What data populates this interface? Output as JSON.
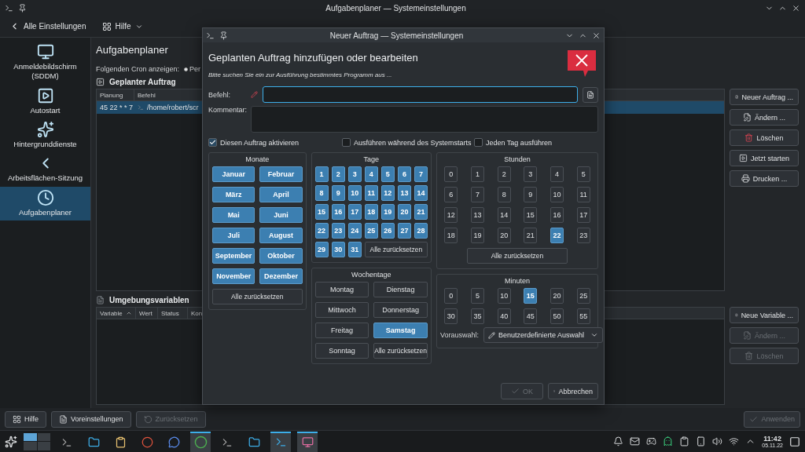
{
  "main_window": {
    "title": "Aufgabenplaner — Systemeinstellungen",
    "back": "Alle Einstellungen",
    "help": "Hilfe"
  },
  "sidebar": {
    "items": [
      {
        "label": "Anmeldebildschirm (SDDM)",
        "selected": false
      },
      {
        "label": "Autostart",
        "selected": false
      },
      {
        "label": "Hintergrunddienste",
        "selected": false
      },
      {
        "label": "Arbeitsflächen-Sitzung",
        "selected": false
      },
      {
        "label": "Aufgabenplaner",
        "selected": true
      }
    ]
  },
  "page": {
    "title": "Aufgabenplaner",
    "cron_label": "Folgenden Cron anzeigen:",
    "cron_option": {
      "label": "Per",
      "selected": true
    },
    "jobs": {
      "title": "Geplanter Auftrag",
      "columns": [
        "Planung",
        "Befehl"
      ],
      "rows": [
        {
          "cells": [
            "45 22 * * 7",
            "/home/robert/scr"
          ],
          "selected": true
        }
      ],
      "buttons": [
        {
          "label": "Neuer Auftrag ...",
          "disabled": false
        },
        {
          "label": "Ändern ...",
          "disabled": false
        },
        {
          "label": "Löschen",
          "disabled": false
        },
        {
          "label": "Jetzt starten",
          "disabled": false
        },
        {
          "label": "Drucken ...",
          "disabled": false
        }
      ]
    },
    "variables": {
      "title": "Umgebungsvariablen",
      "columns": [
        "Variable",
        "Wert",
        "Status",
        "Kon"
      ],
      "buttons": [
        {
          "label": "Neue Variable ...",
          "disabled": false
        },
        {
          "label": "Ändern ...",
          "disabled": true
        },
        {
          "label": "Löschen",
          "disabled": true
        }
      ]
    }
  },
  "footer": {
    "buttons": [
      {
        "label": "Hilfe",
        "disabled": false
      },
      {
        "label": "Voreinstellungen",
        "disabled": false
      },
      {
        "label": "Zurücksetzen",
        "disabled": true
      }
    ],
    "apply": {
      "label": "Anwenden",
      "disabled": true
    }
  },
  "taskbar": {
    "time": "11:42",
    "date": "05.11.22"
  },
  "dialog": {
    "title": "Neuer Auftrag — Systemeinstellungen",
    "heading": "Geplanten Auftrag hinzufügen oder bearbeiten",
    "hint": "Bitte suchen Sie ein zur Ausführung bestimmtes Programm aus ...",
    "command_label": "Befehl:",
    "comment_label": "Kommentar:",
    "options": [
      {
        "label": "Diesen Auftrag aktivieren",
        "checked": true
      },
      {
        "label": "Ausführen während des Systemstarts",
        "checked": false
      },
      {
        "label": "Jeden Tag ausführen",
        "checked": false
      }
    ],
    "months": {
      "title": "Monate",
      "reset": "Alle zurücksetzen",
      "items": [
        {
          "label": "Januar",
          "selected": true
        },
        {
          "label": "Februar",
          "selected": true
        },
        {
          "label": "März",
          "selected": true
        },
        {
          "label": "April",
          "selected": true
        },
        {
          "label": "Mai",
          "selected": true
        },
        {
          "label": "Juni",
          "selected": true
        },
        {
          "label": "Juli",
          "selected": true
        },
        {
          "label": "August",
          "selected": true
        },
        {
          "label": "September",
          "selected": true
        },
        {
          "label": "Oktober",
          "selected": true
        },
        {
          "label": "November",
          "selected": true
        },
        {
          "label": "Dezember",
          "selected": true
        }
      ]
    },
    "days": {
      "title": "Tage",
      "reset": "Alle zurücksetzen",
      "items": [
        {
          "label": "1",
          "selected": true
        },
        {
          "label": "2",
          "selected": true
        },
        {
          "label": "3",
          "selected": true
        },
        {
          "label": "4",
          "selected": true
        },
        {
          "label": "5",
          "selected": true
        },
        {
          "label": "6",
          "selected": true
        },
        {
          "label": "7",
          "selected": true
        },
        {
          "label": "8",
          "selected": true
        },
        {
          "label": "9",
          "selected": true
        },
        {
          "label": "10",
          "selected": true
        },
        {
          "label": "11",
          "selected": true
        },
        {
          "label": "12",
          "selected": true
        },
        {
          "label": "13",
          "selected": true
        },
        {
          "label": "14",
          "selected": true
        },
        {
          "label": "15",
          "selected": true
        },
        {
          "label": "16",
          "selected": true
        },
        {
          "label": "17",
          "selected": true
        },
        {
          "label": "18",
          "selected": true
        },
        {
          "label": "19",
          "selected": true
        },
        {
          "label": "20",
          "selected": true
        },
        {
          "label": "21",
          "selected": true
        },
        {
          "label": "22",
          "selected": true
        },
        {
          "label": "23",
          "selected": true
        },
        {
          "label": "24",
          "selected": true
        },
        {
          "label": "25",
          "selected": true
        },
        {
          "label": "26",
          "selected": true
        },
        {
          "label": "27",
          "selected": true
        },
        {
          "label": "28",
          "selected": true
        },
        {
          "label": "29",
          "selected": true
        },
        {
          "label": "30",
          "selected": true
        },
        {
          "label": "31",
          "selected": true
        }
      ]
    },
    "hours": {
      "title": "Stunden",
      "reset": "Alle zurücksetzen",
      "items": [
        {
          "label": "0",
          "selected": false
        },
        {
          "label": "1",
          "selected": false
        },
        {
          "label": "2",
          "selected": false
        },
        {
          "label": "3",
          "selected": false
        },
        {
          "label": "4",
          "selected": false
        },
        {
          "label": "5",
          "selected": false
        },
        {
          "label": "6",
          "selected": false
        },
        {
          "label": "7",
          "selected": false
        },
        {
          "label": "8",
          "selected": false
        },
        {
          "label": "9",
          "selected": false
        },
        {
          "label": "10",
          "selected": false
        },
        {
          "label": "11",
          "selected": false
        },
        {
          "label": "12",
          "selected": false
        },
        {
          "label": "13",
          "selected": false
        },
        {
          "label": "14",
          "selected": false
        },
        {
          "label": "15",
          "selected": false
        },
        {
          "label": "16",
          "selected": false
        },
        {
          "label": "17",
          "selected": false
        },
        {
          "label": "18",
          "selected": false
        },
        {
          "label": "19",
          "selected": false
        },
        {
          "label": "20",
          "selected": false
        },
        {
          "label": "21",
          "selected": false
        },
        {
          "label": "22",
          "selected": true
        },
        {
          "label": "23",
          "selected": false
        }
      ]
    },
    "weekdays": {
      "title": "Wochentage",
      "reset": "Alle zurücksetzen",
      "items": [
        {
          "label": "Montag",
          "selected": false
        },
        {
          "label": "Dienstag",
          "selected": false
        },
        {
          "label": "Mittwoch",
          "selected": false
        },
        {
          "label": "Donnerstag",
          "selected": false
        },
        {
          "label": "Freitag",
          "selected": false
        },
        {
          "label": "Samstag",
          "selected": true
        },
        {
          "label": "Sonntag",
          "selected": false
        }
      ]
    },
    "minutes": {
      "title": "Minuten",
      "preset_label": "Vorauswahl:",
      "preset": "Benutzerdefinierte Auswahl",
      "items": [
        {
          "label": "0",
          "selected": false
        },
        {
          "label": "5",
          "selected": false
        },
        {
          "label": "10",
          "selected": false
        },
        {
          "label": "15",
          "selected": true
        },
        {
          "label": "20",
          "selected": false
        },
        {
          "label": "25",
          "selected": false
        },
        {
          "label": "30",
          "selected": false
        },
        {
          "label": "35",
          "selected": false
        },
        {
          "label": "40",
          "selected": false
        },
        {
          "label": "45",
          "selected": false
        },
        {
          "label": "50",
          "selected": false
        },
        {
          "label": "55",
          "selected": false
        }
      ]
    },
    "buttons": [
      {
        "label": "OK",
        "disabled": true
      },
      {
        "label": "Abbrechen",
        "disabled": false
      }
    ]
  }
}
